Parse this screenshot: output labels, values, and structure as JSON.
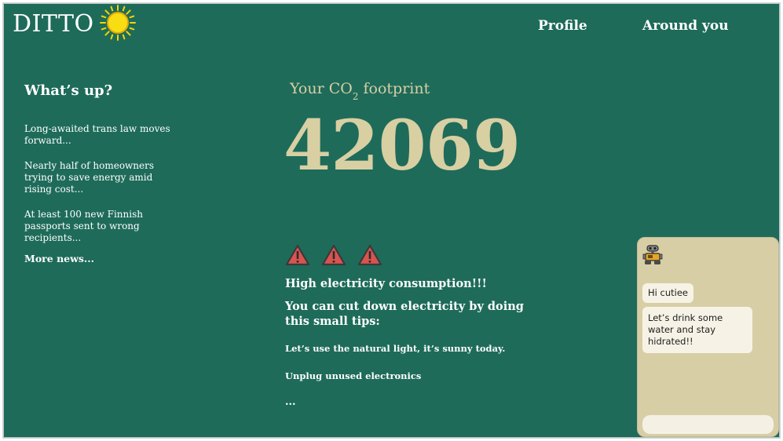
{
  "header": {
    "brand": "DITTO",
    "logo_icon": "sun-icon",
    "nav": [
      {
        "label": "Profile"
      },
      {
        "label": "Around you"
      }
    ]
  },
  "news": {
    "heading": "What’s up?",
    "items": [
      {
        "text": "Long-awaited trans law moves forward..."
      },
      {
        "text": "Nearly half of homeowners trying to save energy amid rising cost..."
      },
      {
        "text": "At least 100 new Finnish passports sent to wrong recipients..."
      }
    ],
    "more_label": "More news..."
  },
  "footprint": {
    "label_prefix": "Your CO",
    "label_subscript": "2",
    "label_suffix": " footprint",
    "value": "42069"
  },
  "alerts": {
    "warning_icon": "warning-triangle-icon",
    "warning_count": 3,
    "title": "High electricity consumption!!!",
    "body": "You can cut down electricity by doing this small tips:",
    "tips": [
      "Let’s use the natural light, it’s sunny today.",
      "Unplug unused electronics",
      "..."
    ]
  },
  "chat": {
    "avatar_icon": "robot-icon",
    "messages": [
      {
        "text": "Hi cutiee"
      },
      {
        "text": "Let’s drink some water and stay hidrated!!"
      }
    ],
    "input_placeholder": ""
  },
  "colors": {
    "background": "#1e6b5a",
    "accent_beige": "#d8cfa3",
    "chat_panel": "#d8cea6",
    "warning_red": "#d9534f"
  }
}
